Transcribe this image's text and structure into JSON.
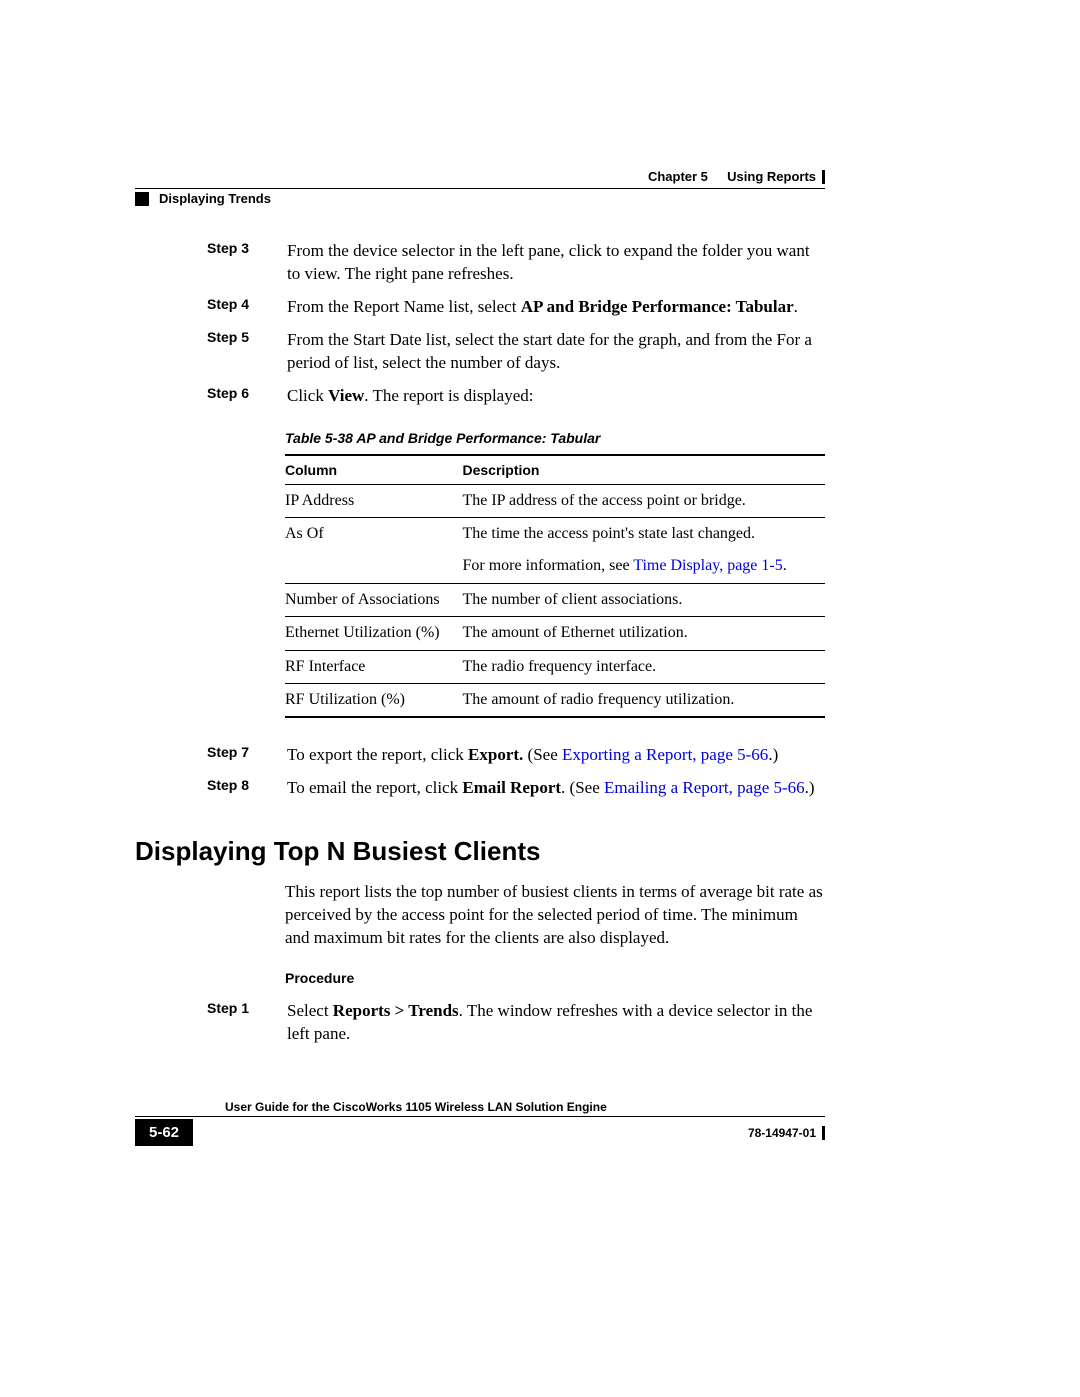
{
  "header": {
    "chapter": "Chapter 5",
    "chapterTitle": "Using Reports",
    "section": "Displaying Trends"
  },
  "steps_a": [
    {
      "label": "Step 3",
      "text_pre": "From the device selector in the left pane, click to expand the folder you want to view. The right pane refreshes.",
      "bold": "",
      "text_post": ""
    },
    {
      "label": "Step 4",
      "text_pre": "From the Report Name list, select ",
      "bold": "AP and Bridge Performance: Tabular",
      "text_post": "."
    },
    {
      "label": "Step 5",
      "text_pre": "From the Start Date list, select the start date for the graph, and from the For a period of list, select the number of days.",
      "bold": "",
      "text_post": ""
    },
    {
      "label": "Step 6",
      "text_pre": "Click ",
      "bold": "View",
      "text_post": ". The report is displayed:"
    }
  ],
  "table": {
    "caption": "Table 5-38    AP and Bridge Performance: Tabular",
    "head_col": "Column",
    "head_desc": "Description",
    "rows": [
      {
        "col": "IP Address",
        "desc": "The IP address of the access point or bridge."
      },
      {
        "col": "As Of",
        "desc": "The time the access point's state last changed."
      }
    ],
    "asof_extra_pre": "For more information, see ",
    "asof_link": "Time Display, page 1-5",
    "asof_extra_post": ".",
    "rows2": [
      {
        "col": "Number of Associations",
        "desc": "The number of client associations."
      },
      {
        "col": "Ethernet Utilization (%)",
        "desc": "The amount of Ethernet utilization."
      },
      {
        "col": "RF Interface",
        "desc": "The radio frequency interface."
      },
      {
        "col": "RF Utilization (%)",
        "desc": "The amount of radio frequency utilization."
      }
    ]
  },
  "steps_b": [
    {
      "label": "Step 7",
      "pre": "To export the report, click ",
      "bold": "Export.",
      "mid": " (See ",
      "link": "Exporting a Report, page 5-66",
      "post": ".)"
    },
    {
      "label": "Step 8",
      "pre": "To email the report, click ",
      "bold": "Email Report",
      "mid": ". (See ",
      "link": "Emailing a Report, page 5-66",
      "post": ".)"
    }
  ],
  "heading": "Displaying Top N Busiest Clients",
  "para": "This report lists the top number of busiest clients in terms of average bit rate as perceived by the access point for the selected period of time. The minimum and maximum bit rates for the clients are also displayed.",
  "procedure": "Procedure",
  "step1": {
    "label": "Step 1",
    "pre": "Select ",
    "bold": "Reports > Trends",
    "post": ". The window refreshes with a device selector in the left pane."
  },
  "footer": {
    "title": "User Guide for the CiscoWorks 1105 Wireless LAN Solution Engine",
    "page": "5-62",
    "doc": "78-14947-01"
  }
}
